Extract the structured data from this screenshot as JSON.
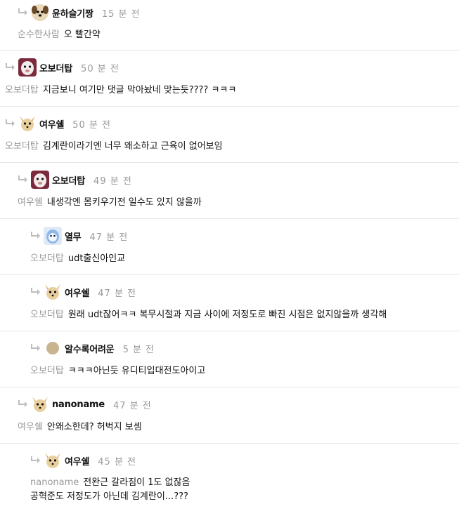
{
  "comments": [
    {
      "nick": "윤하슬기짱",
      "time": "15 분 전",
      "mention": "순수한사람",
      "text": "오 빨간약",
      "avatar": "dog-avatar-icon"
    },
    {
      "nick": "오보더탑",
      "time": "50 분 전",
      "mention": "오보더탑",
      "text": "지금보니 여기만 댓글 막아놨네 맞는듯???? ㅋㅋㅋ",
      "avatar": "alpaca-avatar-icon"
    },
    {
      "nick": "여우쉘",
      "time": "50 분 전",
      "mention": "오보더탑",
      "text": "김계란이라기엔 너무 왜소하고 근육이 없어보임",
      "avatar": "fox-avatar-icon"
    },
    {
      "nick": "오보더탑",
      "time": "49 분 전",
      "mention": "여우쉘",
      "text": "내생각엔 몸키우기전 일수도 있지 않을까",
      "avatar": "alpaca-avatar-icon"
    },
    {
      "nick": "열무",
      "time": "47 분 전",
      "mention": "오보더탑",
      "text": "udt출신아인교",
      "avatar": "blue-character-avatar-icon"
    },
    {
      "nick": "여우쉘",
      "time": "47 분 전",
      "mention": "오보더탑",
      "text": "원래 udt잖어ㅋㅋ 복무시절과 지금 사이에 저정도로 빠진 시점은 없지않을까 생각해",
      "avatar": "fox-avatar-icon"
    },
    {
      "nick": "알수록어려운",
      "time": "5 분 전",
      "mention": "오보더탑",
      "text": "ㅋㅋㅋ아닌듯 유디티입대전도아이고",
      "avatar": "default-circle-avatar-icon"
    },
    {
      "nick": "nanoname",
      "time": "47 분 전",
      "mention": "여우쉘",
      "text": "안왜소한데? 허벅지 보셈",
      "avatar": "fox-avatar-icon"
    },
    {
      "nick": "여우쉘",
      "time": "45 분 전",
      "mention": "nanoname",
      "text": "전완근 갈라짐이 1도 없잖음",
      "text2": "공혁준도 저정도가 아닌데 김계란이...???",
      "avatar": "fox-avatar-icon"
    }
  ]
}
